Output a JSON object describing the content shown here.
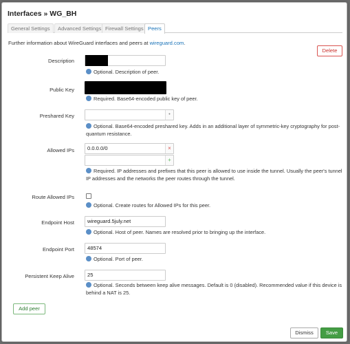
{
  "modal": {
    "title": "Interfaces » WG_BH",
    "tabs": [
      "General Settings",
      "Advanced Settings",
      "Firewall Settings",
      "Peers"
    ],
    "active_tab": "Peers",
    "info_prefix": "Further information about WireGuard interfaces and peers at ",
    "info_link": "wireguard.com",
    "info_suffix": "."
  },
  "buttons": {
    "delete": "Delete",
    "add_peer": "Add peer",
    "dismiss": "Dismiss",
    "save": "Save"
  },
  "fields": {
    "description": {
      "label": "Description",
      "value": "",
      "hint": "Optional. Description of peer."
    },
    "public_key": {
      "label": "Public Key",
      "value": "",
      "hint": "Required. Base64-encoded public key of peer."
    },
    "preshared_key": {
      "label": "Preshared Key",
      "value": "",
      "hint_line1": "Optional. Base64-encoded preshared key. Adds in an additional layer of symmetric-key cryptography for post-",
      "hint_line2": "quantum resistance."
    },
    "allowed_ips": {
      "label": "Allowed IPs",
      "value": "0.0.0.0/0",
      "value2": "",
      "hint_line1": "Required. IP addresses and prefixes that this peer is allowed to use inside the tunnel. Usually the peer's tunnel",
      "hint_line2": "IP addresses and the networks the peer routes through the tunnel."
    },
    "route_allowed_ips": {
      "label": "Route Allowed IPs",
      "checked": false,
      "hint": "Optional. Create routes for Allowed IPs for this peer."
    },
    "endpoint_host": {
      "label": "Endpoint Host",
      "value": "wireguard.5july.net",
      "hint": "Optional. Host of peer. Names are resolved prior to bringing up the interface."
    },
    "endpoint_port": {
      "label": "Endpoint Port",
      "value": "48574",
      "hint": "Optional. Port of peer."
    },
    "keepalive": {
      "label": "Persistent Keep Alive",
      "value": "25",
      "hint_line1": "Optional. Seconds between keep alive messages. Default is 0 (disabled). Recommended value if this device is",
      "hint_line2": "behind a NAT is 25."
    }
  },
  "colors": {
    "accent": "#1a73b8",
    "save": "#449d44",
    "delete": "#d9534f"
  }
}
